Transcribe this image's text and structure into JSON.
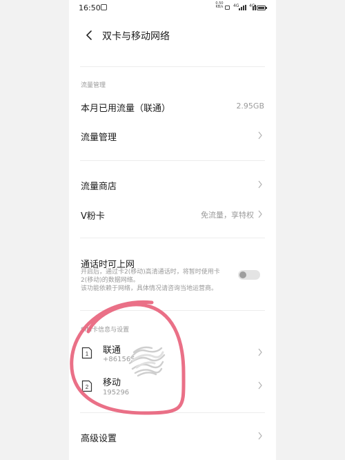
{
  "status_bar": {
    "time": "16:50",
    "net_speed_value": "0.50",
    "net_speed_unit": "KB/s",
    "signal1_label": "4G",
    "signal2_label": "4G"
  },
  "header": {
    "title": "双卡与移动网络"
  },
  "data_section": {
    "label": "流量管理",
    "usage_label": "本月已用流量（联通）",
    "usage_value": "2.95GB",
    "manage_label": "流量管理"
  },
  "store_section": {
    "store_label": "流量商店",
    "vcard_label": "V粉卡",
    "vcard_value": "免流量，享特权"
  },
  "calling_section": {
    "label": "通话时可上网",
    "desc_line1": "开启后，通过卡2(移动)高清通话时，将暂时使用卡",
    "desc_line2": "2(移动)的数据网络。",
    "desc_line3": "该功能依赖于网络，具体情况请咨询当地运营商。",
    "toggle_on": false
  },
  "sim_section": {
    "label": "SIM卡信息与设置",
    "sims": [
      {
        "slot": "1",
        "name": "联通",
        "number": "+861565"
      },
      {
        "slot": "2",
        "name": "移动",
        "number": "195296"
      }
    ]
  },
  "advanced": {
    "label": "高级设置"
  },
  "colors": {
    "annotation": "#e8607a",
    "text_primary": "#1a1a1a",
    "text_secondary": "#9a9a9a"
  }
}
